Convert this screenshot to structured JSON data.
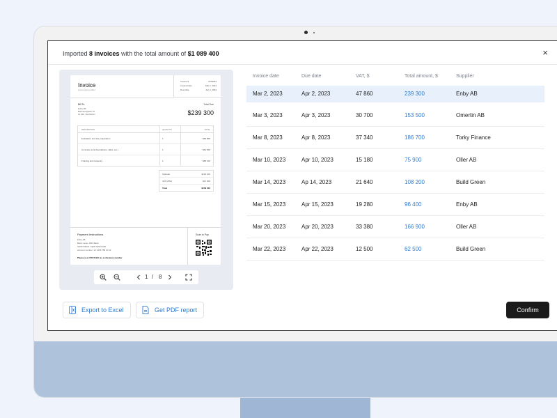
{
  "header": {
    "prefix": "Imported ",
    "count": "8 invoices",
    "middle": " with the total amount of ",
    "amount": "$1 089 400"
  },
  "close_icon": "×",
  "preview": {
    "doc_title": "Invoice",
    "doc_subtitle": "Lorem ipsum dolor",
    "meta": [
      {
        "label": "Invoice #",
        "value": "6709033"
      },
      {
        "label": "Invoice Date",
        "value": "Mar 2, 2023"
      },
      {
        "label": "Due Date",
        "value": "Apr 2, 2023"
      }
    ],
    "bill_to_label": "Bill To",
    "bill_to_lines": [
      "Enby AB",
      "Bellmansgatan 10",
      "11 224, Stockholm"
    ],
    "total_due_label": "Total Due",
    "total_due": "$239 300",
    "table_head": [
      "DESCRIPTION",
      "QUANTITY",
      "TOTAL"
    ],
    "table_rows": [
      {
        "desc": "Evaluation and site preparation",
        "qty": "1",
        "total": "$63 800"
      },
      {
        "desc": "Concrete work (foundations, slabs, etc.)",
        "qty": "1",
        "total": "$61 500"
      },
      {
        "desc": "Framing and carpentry",
        "qty": "1",
        "total": "$66 100"
      }
    ],
    "summary": [
      {
        "label": "Subtotal",
        "value": "$191 400"
      },
      {
        "label": "VAT (25%)",
        "value": "$47 900"
      },
      {
        "label": "Total",
        "value": "$239 300"
      }
    ],
    "payment_title": "Payment Instructions",
    "payment_lines": [
      "Enby AB",
      "Bank name: ABC Bank",
      "SWIFT/IBAN: SE49 5000 0000",
      "Account number: 12 3456 789 00 12"
    ],
    "payment_note": "Please use CTR-51121 as a reference number",
    "scan_label": "Scan to Pay",
    "pager": {
      "current": "1",
      "sep": "/",
      "total": "8"
    }
  },
  "table": {
    "headers": [
      "Invoice date",
      "Due date",
      "VAT, $",
      "Total amount, $",
      "Supplier"
    ],
    "rows": [
      {
        "invoice_date": "Mar 2, 2023",
        "due_date": "Apr 2, 2023",
        "vat": "47 860",
        "total": "239 300",
        "supplier": "Enby AB"
      },
      {
        "invoice_date": "Mar 3, 2023",
        "due_date": "Apr 3, 2023",
        "vat": "30 700",
        "total": "153 500",
        "supplier": "Omertin AB"
      },
      {
        "invoice_date": "Mar 8, 2023",
        "due_date": "Apr 8, 2023",
        "vat": "37 340",
        "total": "186 700",
        "supplier": "Torky Finance"
      },
      {
        "invoice_date": "Mar 10, 2023",
        "due_date": "Apr 10, 2023",
        "vat": "15 180",
        "total": "75 900",
        "supplier": "Oller AB"
      },
      {
        "invoice_date": "Mar 14, 2023",
        "due_date": "Ap 14, 2023",
        "vat": "21 640",
        "total": "108 200",
        "supplier": "Build Green"
      },
      {
        "invoice_date": "Mar 15, 2023",
        "due_date": "Apr 15, 2023",
        "vat": "19 280",
        "total": "96 400",
        "supplier": "Enby AB"
      },
      {
        "invoice_date": "Mar 20, 2023",
        "due_date": "Apr 20, 2023",
        "vat": "33 380",
        "total": "166 900",
        "supplier": "Oller AB"
      },
      {
        "invoice_date": "Mar 22, 2023",
        "due_date": "Apr 22, 2023",
        "vat": "12 500",
        "total": "62 500",
        "supplier": "Build Green"
      }
    ]
  },
  "buttons": {
    "export_excel": "Export to Excel",
    "pdf_report": "Get PDF report",
    "confirm": "Confirm"
  },
  "colors": {
    "accent": "#2f7bd1",
    "selected_row": "#e8f0fb",
    "confirm_bg": "#1b1b1b",
    "chin": "#aec2dc"
  }
}
